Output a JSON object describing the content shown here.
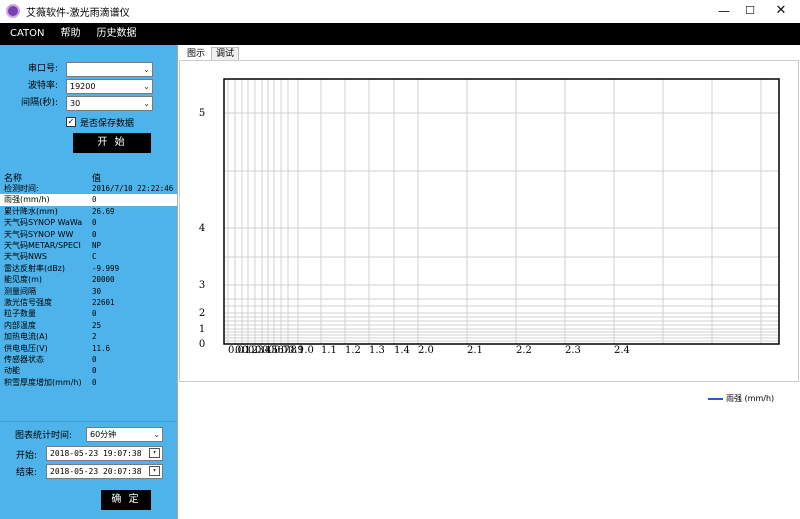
{
  "window": {
    "title": "艾薇软件-激光雨滴谱仪",
    "minimize_glyph": "—",
    "maximize_glyph": "☐",
    "close_glyph": "✕"
  },
  "menu": [
    "CATON",
    "帮助",
    "历史数据"
  ],
  "serial_form": {
    "port_label": "串口号:",
    "port_value": "",
    "baud_label": "波特率:",
    "baud_value": "19200",
    "interval_label": "间隔(秒):",
    "interval_value": "30",
    "save_checked": true,
    "save_label": "是否保存数据",
    "start_button": "开 始"
  },
  "table": {
    "header_name": "名称",
    "header_value": "值",
    "rows": [
      {
        "name": "检测时间:",
        "value": "2016/7/10 22:22:46"
      },
      {
        "name": "雨强(mm/h)",
        "value": "0"
      },
      {
        "name": "累计降水(mm)",
        "value": "26.69"
      },
      {
        "name": "天气码SYNOP WaWa",
        "value": "0"
      },
      {
        "name": "天气码SYNOP WW",
        "value": "0"
      },
      {
        "name": "天气码METAR/SPECI",
        "value": "  NP"
      },
      {
        "name": "天气码NWS",
        "value": "  C"
      },
      {
        "name": "雷达反射率(dBz)",
        "value": "-9.999"
      },
      {
        "name": "能见度(m)",
        "value": "20000"
      },
      {
        "name": "测量间隔",
        "value": "30"
      },
      {
        "name": "激光信号强度",
        "value": "22601"
      },
      {
        "name": "粒子数量",
        "value": "0"
      },
      {
        "name": "内部温度",
        "value": "25"
      },
      {
        "name": "加热电流(A)",
        "value": "2"
      },
      {
        "name": "供电电压(V)",
        "value": "11.6"
      },
      {
        "name": "传感器状态",
        "value": "0"
      },
      {
        "name": "动能",
        "value": "0"
      },
      {
        "name": "积雪厚度增加(mm/h)",
        "value": "0"
      }
    ]
  },
  "stats_form": {
    "period_label": "图表统计时间:",
    "period_value": "60分钟",
    "start_label": "开始:",
    "start_value": "2018-05-23 19:07:38",
    "end_label": "结束:",
    "end_value": "2018-05-23 20:07:38",
    "ok_button": "确 定"
  },
  "tabs": [
    {
      "label": "图示",
      "active": true
    },
    {
      "label": "调试",
      "active": false
    }
  ],
  "chart_data": {
    "type": "line",
    "series": [
      {
        "name": "雨强 (mm/h)",
        "values": []
      }
    ],
    "y_tick_labels": [
      "5",
      "4",
      "3",
      "2",
      "1",
      "0"
    ],
    "x_tick_labels": [
      "0.0",
      "0.1",
      "0.2",
      "0.3",
      "0.4",
      "0.5",
      "0.6",
      "0.7",
      "0.8",
      "0.9",
      "1.0",
      "1.1",
      "1.2",
      "1.3",
      "1.4",
      "2.0",
      "2.1",
      "2.2",
      "2.3",
      "2.4"
    ],
    "grid": true,
    "legend_position": "bottom-right",
    "line_color": "#1f5fd6"
  }
}
